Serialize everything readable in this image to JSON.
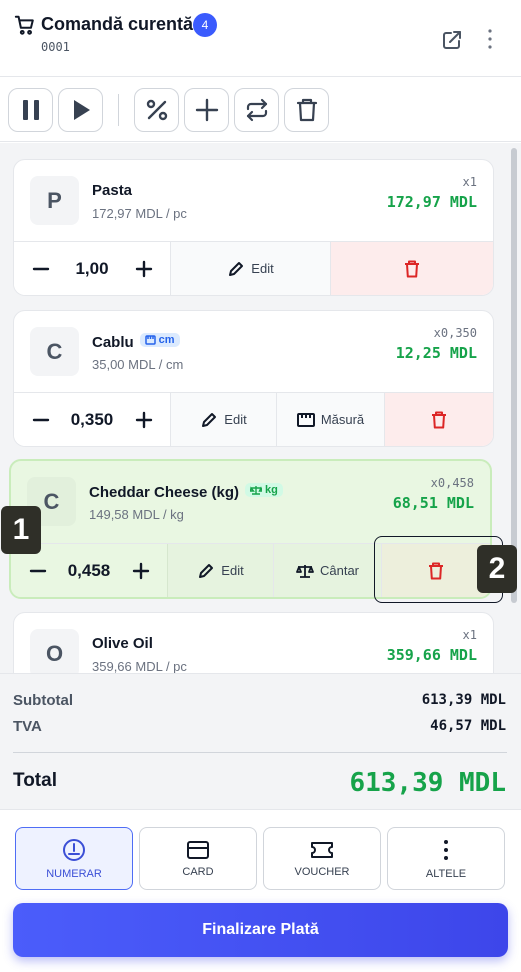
{
  "header": {
    "title": "Comandă curentă",
    "badge_count": "4",
    "order_number": "0001"
  },
  "toolbar": {
    "buttons": [
      "pause-icon",
      "play-icon",
      "percent-icon",
      "plus-icon",
      "repeat-icon",
      "trash-icon"
    ]
  },
  "items": [
    {
      "initial": "P",
      "name": "Pasta",
      "unit_badge": "",
      "unit_price": "172,97 MDL / pc",
      "qty_label": "x1",
      "total": "172,97 MDL",
      "qty": "1,00",
      "edit_label": "Edit",
      "extra_label": ""
    },
    {
      "initial": "C",
      "name": "Cablu",
      "unit_badge": "cm",
      "unit_price": "35,00 MDL / cm",
      "qty_label": "x0,350",
      "total": "12,25 MDL",
      "qty": "0,350",
      "edit_label": "Edit",
      "extra_label": "Măsură"
    },
    {
      "initial": "C",
      "name": "Cheddar Cheese (kg)",
      "unit_badge": "kg",
      "unit_price": "149,58 MDL / kg",
      "qty_label": "x0,458",
      "total": "68,51 MDL",
      "qty": "0,458",
      "edit_label": "Edit",
      "extra_label": "Cântar",
      "selected": true
    },
    {
      "initial": "O",
      "name": "Olive Oil",
      "unit_badge": "",
      "unit_price": "359,66 MDL / pc",
      "qty_label": "x1",
      "total": "359,66 MDL"
    }
  ],
  "markers": [
    "1",
    "2"
  ],
  "summary": {
    "subtotal_label": "Subtotal",
    "subtotal_value": "613,39 MDL",
    "tva_label": "TVA",
    "tva_value": "46,57 MDL",
    "total_label": "Total",
    "total_value": "613,39 MDL"
  },
  "payment": {
    "methods": [
      {
        "label": "NUMERAR",
        "icon": "cash-clock-icon",
        "active": true
      },
      {
        "label": "CARD",
        "icon": "card-icon"
      },
      {
        "label": "VOUCHER",
        "icon": "ticket-icon"
      },
      {
        "label": "ALTELE",
        "icon": "more-vertical-icon"
      }
    ],
    "finalize_label": "Finalizare Plată"
  },
  "colors": {
    "accent": "#3b5bfd",
    "price_green": "#16a34a",
    "delete_red": "#dc2626",
    "selected_bg": "#e9f7e2"
  }
}
